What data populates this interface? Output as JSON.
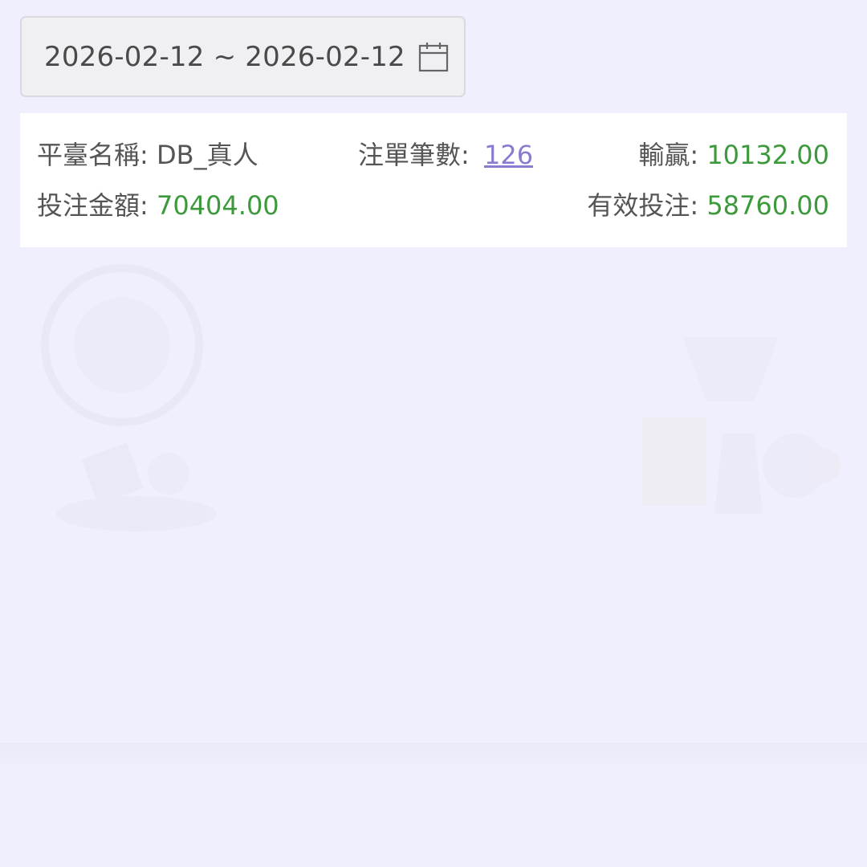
{
  "date_range": {
    "value": "2026-02-12 ~ 2026-02-12",
    "icon": "calendar-icon"
  },
  "summary": {
    "platform_label": "平臺名稱: ",
    "platform_value": "DB_真人",
    "count_label": "注單筆數: ",
    "count_value": "126",
    "winloss_label": "輸贏: ",
    "winloss_value": "10132.00",
    "bet_label": "投注金額: ",
    "bet_value": "70404.00",
    "valid_label": "有效投注: ",
    "valid_value": "58760.00"
  },
  "colors": {
    "background": "#efeffd",
    "value_green": "#3c9a3c",
    "link_purple": "#8a7bd1",
    "label_gray": "#555555"
  }
}
